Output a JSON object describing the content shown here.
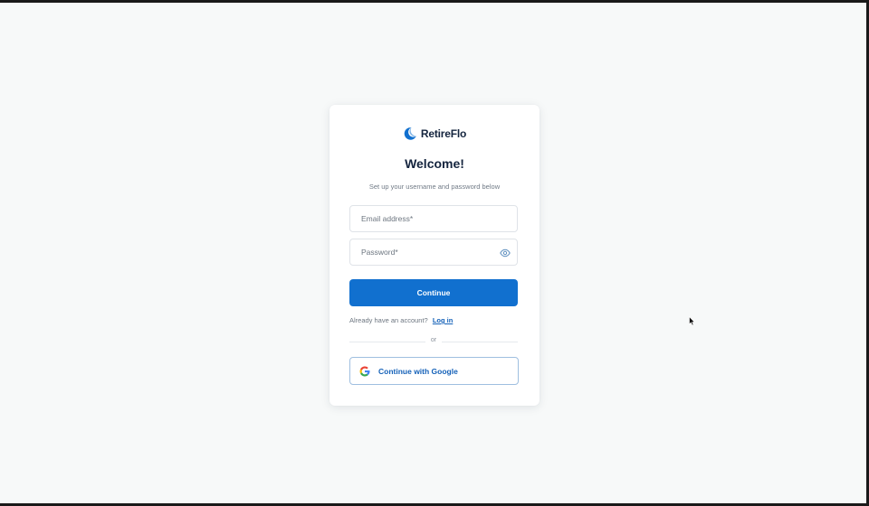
{
  "brand": {
    "name": "RetireFlo",
    "logo_icon": "crescent-logo-icon",
    "accent_color": "#1170cf",
    "text_color": "#14243e"
  },
  "signup": {
    "title": "Welcome!",
    "subtitle": "Set up your username and password below",
    "email": {
      "placeholder": "Email address*",
      "value": ""
    },
    "password": {
      "placeholder": "Password*",
      "value": "",
      "toggle_icon": "eye-icon"
    },
    "continue_label": "Continue",
    "account_prompt": "Already have an account?",
    "login_link": "Log in",
    "divider_text": "or",
    "google_label": "Continue with Google",
    "google_icon": "google-icon"
  }
}
